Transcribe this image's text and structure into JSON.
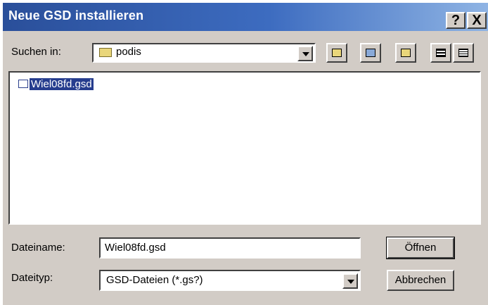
{
  "window": {
    "title": "Neue GSD installieren"
  },
  "titlebar": {
    "help_label": "?",
    "close_label": "X"
  },
  "lookin": {
    "label": "Suchen in:",
    "label_underline_char": "S",
    "current_folder": "podis"
  },
  "toolbar": {
    "icons": [
      "up-one-level-icon",
      "desktop-icon",
      "new-folder-icon",
      "list-view-icon",
      "details-view-icon"
    ]
  },
  "file_list": {
    "items": [
      {
        "name": "Wiel08fd.gsd",
        "selected": true
      }
    ]
  },
  "filename": {
    "label": "Dateiname:",
    "label_underline_char": "i",
    "value": "Wiel08fd.gsd"
  },
  "filetype": {
    "label": "Dateityp:",
    "label_underline_char": "t",
    "value": "GSD-Dateien (*.gs?)"
  },
  "buttons": {
    "open_label": "Öffnen",
    "cancel_label": "Abbrechen"
  },
  "colors": {
    "title_start": "#2a4f9a",
    "title_end": "#8fb4e4",
    "dialog_bg": "#d2ccc6",
    "selection": "#263d8e"
  }
}
